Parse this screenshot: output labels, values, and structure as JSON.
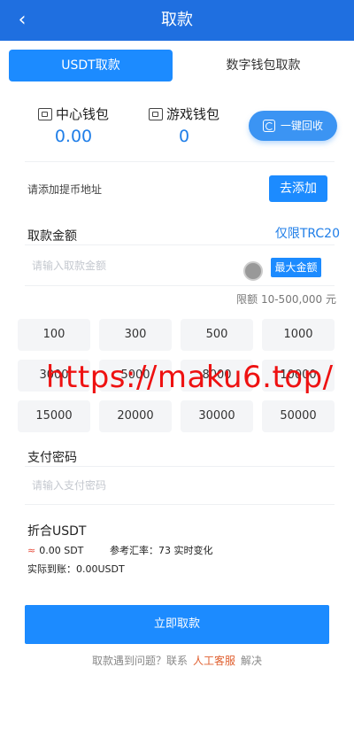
{
  "header": {
    "title": "取款",
    "back_icon": "‹"
  },
  "tabs": [
    {
      "label": "USDT取款",
      "active": true
    },
    {
      "label": "数字钱包取款",
      "active": false
    }
  ],
  "wallets": {
    "center": {
      "name": "中心钱包",
      "amount": "0.00"
    },
    "game": {
      "name": "游戏钱包",
      "amount": "0"
    }
  },
  "recycle": {
    "label": "一键回收"
  },
  "address": {
    "text": "请添加提币地址",
    "button": "去添加"
  },
  "amount_section": {
    "label": "取款金额",
    "trc": "仅限TRC20",
    "placeholder": "请输入取款金额",
    "max_button": "最大金额",
    "limit": "限额 10-500,000 元"
  },
  "quick_amounts": [
    "100",
    "300",
    "500",
    "1000",
    "3000",
    "5000",
    "8000",
    "10000",
    "15000",
    "20000",
    "30000",
    "50000"
  ],
  "watermark": "https://maku6.top/",
  "password": {
    "label": "支付密码",
    "placeholder": "请输入支付密码"
  },
  "usdt": {
    "title": "折合USDT",
    "approx_symbol": "≈",
    "approx_value": "0.00 SDT",
    "rate": "参考汇率：73 实时变化",
    "actual": "实际到账：0.00USDT"
  },
  "submit": {
    "label": "立即取款"
  },
  "help": {
    "prefix": "取款遇到问题？联系",
    "link": "人工客服",
    "suffix": "解决"
  },
  "colors": {
    "primary": "#1c8bff",
    "header": "#1f6fe0",
    "amount": "#1f7ee8",
    "link": "#e06030"
  }
}
